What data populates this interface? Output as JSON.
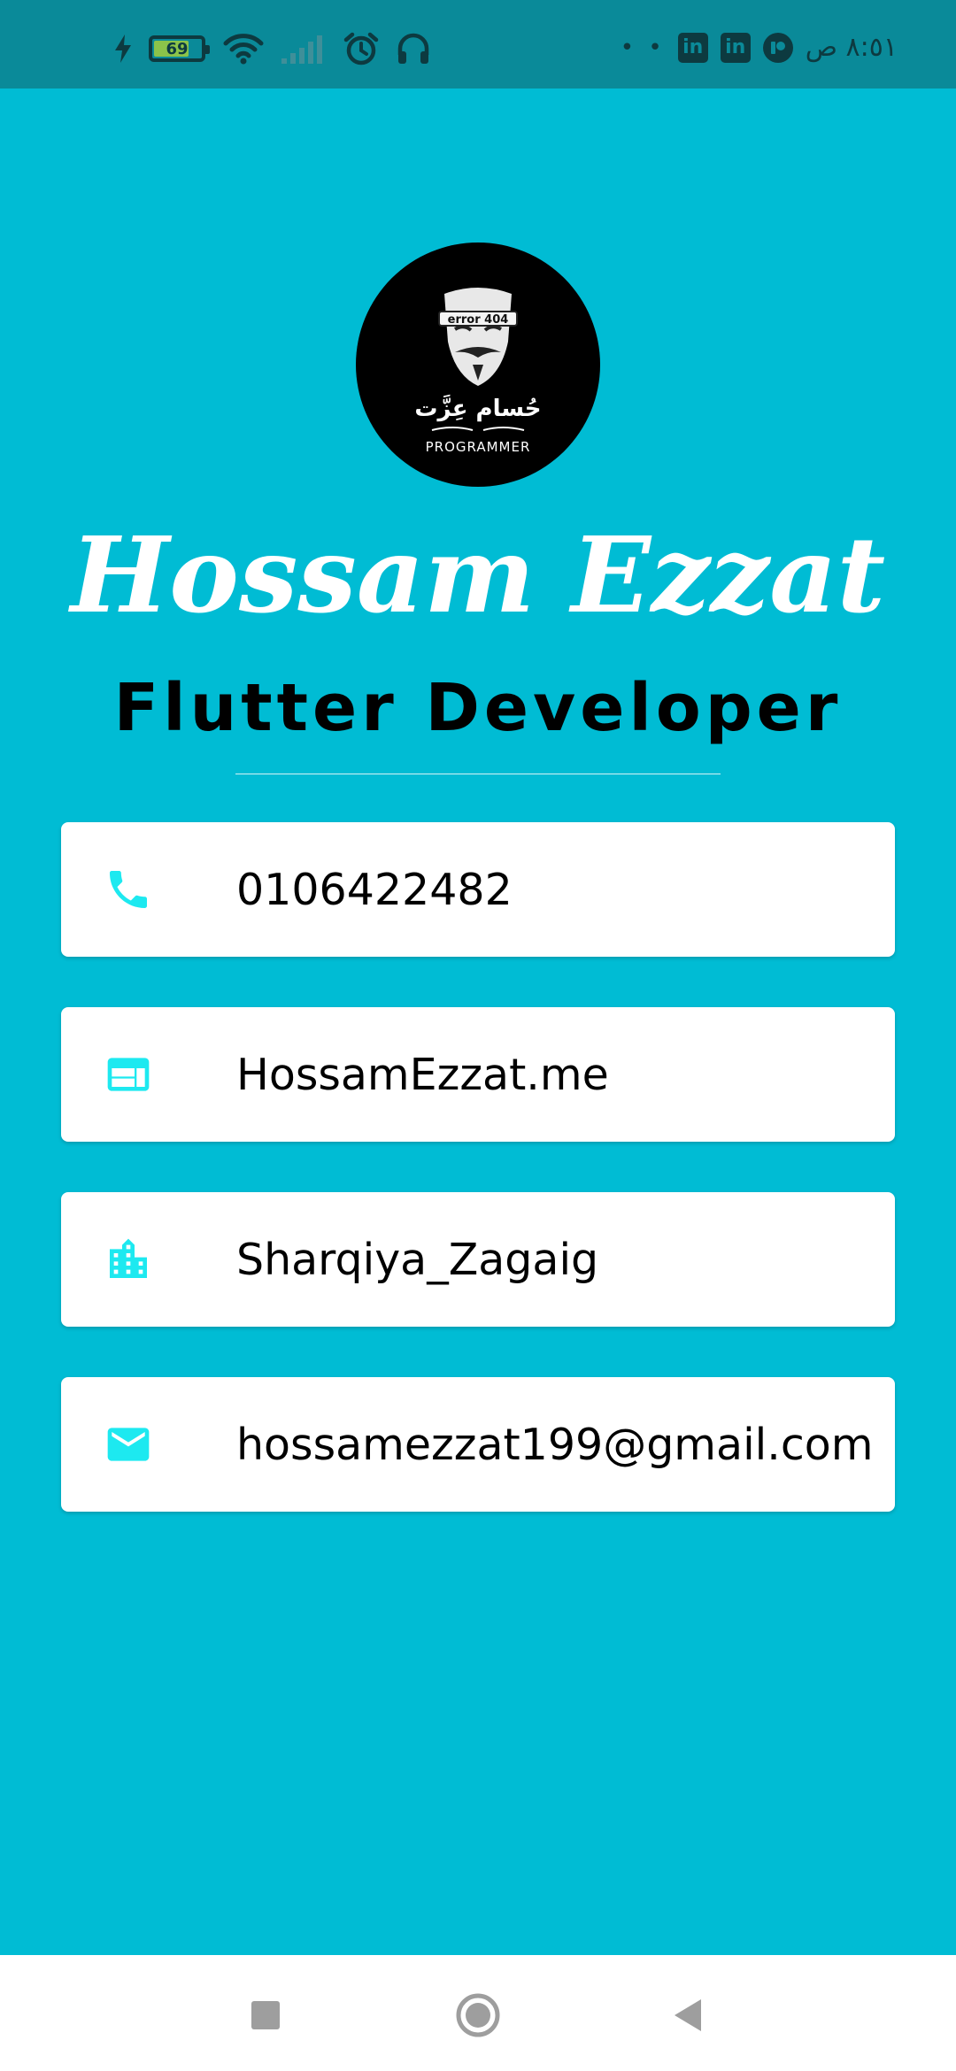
{
  "status_bar": {
    "battery_level": "69",
    "time": "٨:٥١ ص",
    "overflow_dots": "• •",
    "icons": [
      "charging-icon",
      "battery-icon",
      "wifi-icon",
      "signal-icon",
      "alarm-icon",
      "headphones-icon",
      "linkedin-icon",
      "linkedin-icon",
      "app-notification-icon"
    ]
  },
  "profile": {
    "avatar_icon": "anonymous-mask-avatar",
    "avatar_text": {
      "band": "error 404",
      "arabic": "حُسام عِزَّت",
      "subtitle": "PROGRAMMER"
    },
    "name": "Hossam Ezzat",
    "role": "Flutter Developer"
  },
  "contacts": [
    {
      "icon": "phone-icon",
      "value": "0106422482"
    },
    {
      "icon": "web-icon",
      "value": "HossamEzzat.me"
    },
    {
      "icon": "location-city-icon",
      "value": "Sharqiya_Zagaig"
    },
    {
      "icon": "email-icon",
      "value": "hossamezzat199@gmail.com"
    }
  ],
  "nav_bar": {
    "buttons": [
      "recents-button",
      "home-button",
      "back-button"
    ]
  },
  "colors": {
    "background": "#00BCD4",
    "status_bar": "#0A8A99",
    "icon_accent": "#1DE9F0",
    "card": "#FFFFFF",
    "name_text": "#FFFFFF",
    "role_text": "#000000"
  }
}
